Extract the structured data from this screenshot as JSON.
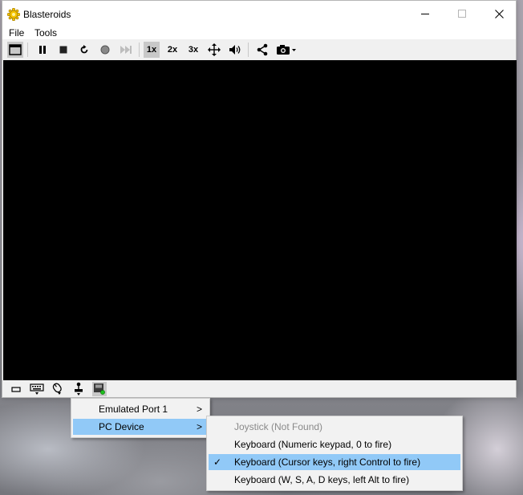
{
  "window": {
    "title": "Blasteroids",
    "controls": {
      "minimize": "–",
      "maximize": "□",
      "close": "✕"
    }
  },
  "menubar": {
    "items": [
      "File",
      "Tools"
    ]
  },
  "toolbar": {
    "speed_1x": "1x",
    "speed_2x": "2x",
    "speed_3x": "3x"
  },
  "context_menu": {
    "items": [
      {
        "label": "Emulated Port 1",
        "submenu_arrow": ">"
      },
      {
        "label": "PC Device",
        "submenu_arrow": ">"
      }
    ]
  },
  "submenu": {
    "items": [
      {
        "label": "Joystick (Not Found)",
        "enabled": false,
        "checked": false
      },
      {
        "label": "Keyboard (Numeric keypad, 0 to fire)",
        "enabled": true,
        "checked": false
      },
      {
        "label": "Keyboard (Cursor keys, right Control to fire)",
        "enabled": true,
        "checked": true
      },
      {
        "label": "Keyboard (W, S, A, D keys, left Alt to fire)",
        "enabled": true,
        "checked": false
      }
    ],
    "check_mark": "✓"
  },
  "colors": {
    "highlight": "#91c9f7",
    "screen": "#000000",
    "toolbar_bg": "#f0f0f0",
    "app_icon": "#f5c400"
  },
  "icons": {
    "app": "gear-sun-icon",
    "toolbar": [
      "window-layout-icon",
      "pause-icon",
      "stop-icon",
      "reset-icon",
      "record-icon",
      "fast-forward-icon",
      "move-icon",
      "volume-icon",
      "share-icon",
      "camera-icon"
    ],
    "statusbar": [
      "cartridge-icon",
      "keyboard-icon",
      "mouse-icon",
      "joystick-icon",
      "disk-drive-icon"
    ]
  }
}
